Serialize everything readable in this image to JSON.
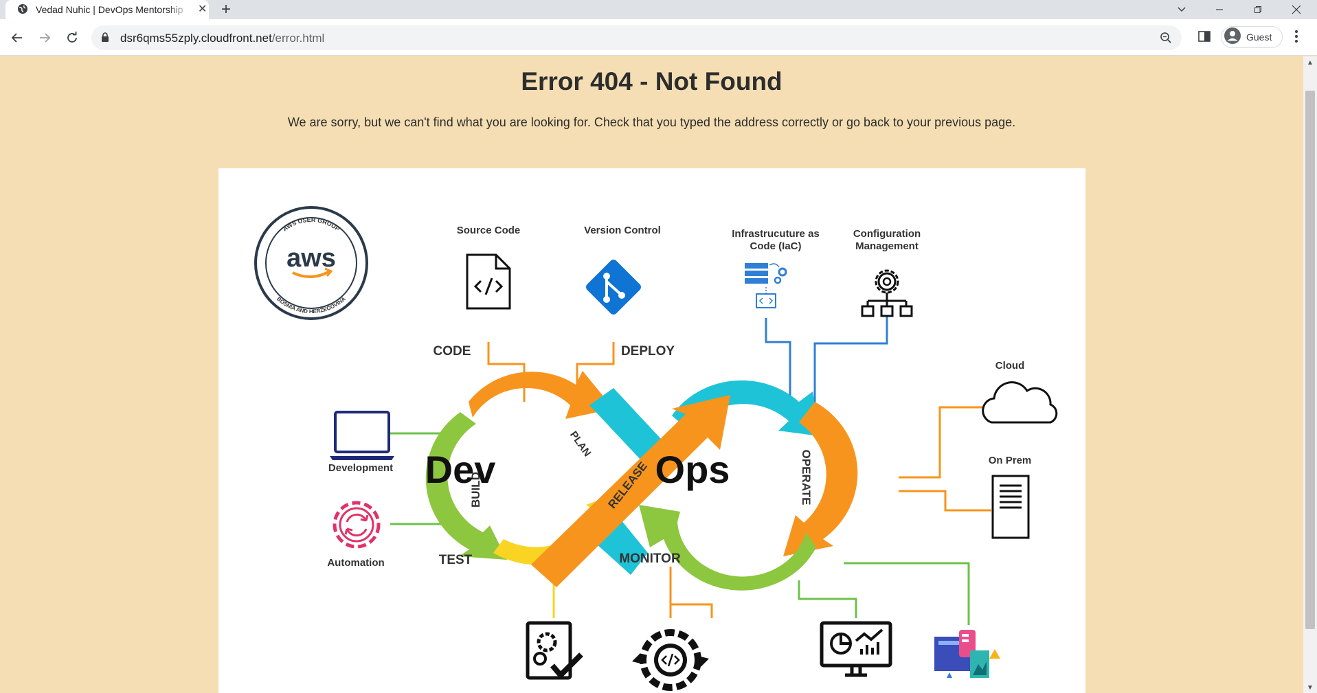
{
  "browser": {
    "tab": {
      "title": "Vedad Nuhic | DevOps Mentorship",
      "close": "✕"
    },
    "new_tab": "+",
    "address": {
      "host": "dsr6qms55zply.cloudfront.net",
      "path": "/error.html"
    },
    "profile": {
      "label": "Guest"
    }
  },
  "page": {
    "title": "Error 404 - Not Found",
    "message": "We are sorry, but we can't find what you are looking for. Check that you typed the address correctly or go back to your previous page."
  },
  "diagram": {
    "logo": {
      "top_text": "AWS USER GROUP",
      "center_text": "aws",
      "bottom_text": "BOSNIA AND HERZEGOVINA"
    },
    "labels": {
      "source_code": "Source Code",
      "version_control": "Version Control",
      "iac_line1": "Infrastrucuture as",
      "iac_line2": "Code (IaC)",
      "config_line1": "Configuration",
      "config_line2": "Management",
      "cloud": "Cloud",
      "on_prem": "On Prem",
      "development": "Development",
      "automation": "Automation"
    },
    "loop": {
      "dev": "Dev",
      "ops": "Ops",
      "code": "CODE",
      "build": "BUILD",
      "test": "TEST",
      "plan": "PLAN",
      "release": "RELEASE",
      "deploy": "DEPLOY",
      "operate": "OPERATE",
      "monitor": "MONITOR"
    },
    "colors": {
      "orange": "#f7941d",
      "green": "#8dc63f",
      "yellow": "#f9d423",
      "cyan": "#1fc3d7",
      "blue_connector": "#2f7fd6",
      "git_blue": "#0f74d4",
      "automation_pink": "#e0336b",
      "dev_navy": "#1e2a78"
    },
    "icons": [
      "source-code-file-icon",
      "git-icon",
      "iac-icon",
      "configuration-icon",
      "cloud-icon",
      "server-icon",
      "laptop-icon",
      "automation-gear-icon",
      "settings-check-icon",
      "code-gear-icon",
      "monitoring-dashboard-icon",
      "analytics-dashboard-icon"
    ]
  }
}
